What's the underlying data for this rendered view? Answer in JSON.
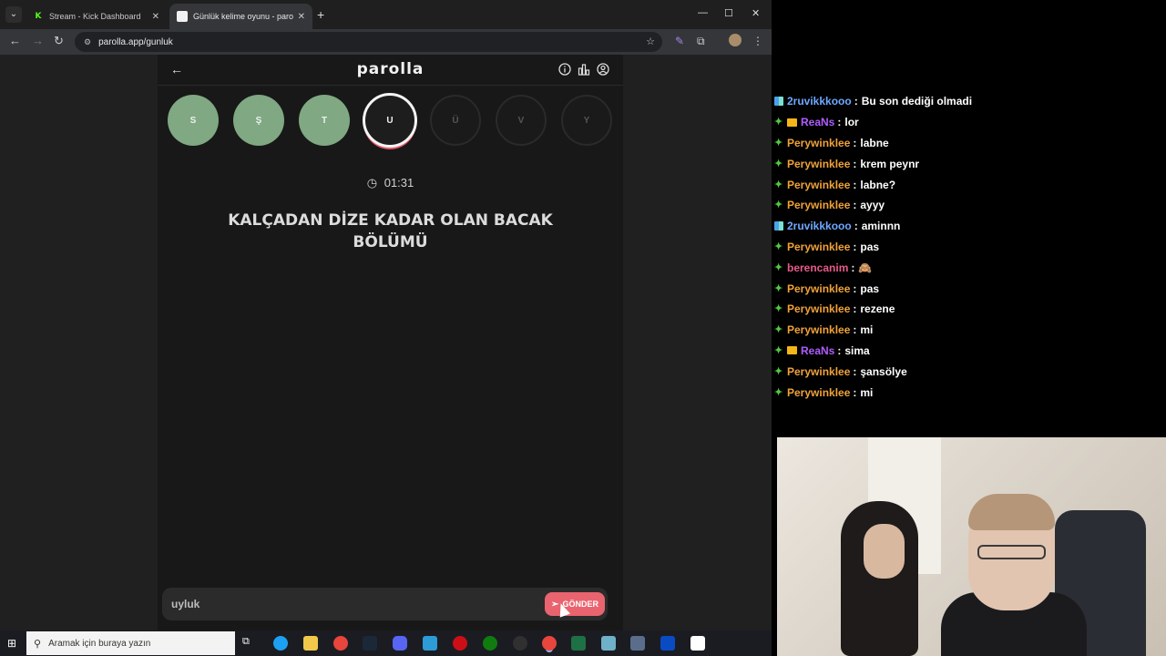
{
  "browser": {
    "tabs": [
      {
        "title": "Stream - Kick Dashboard",
        "favicon": "kick-icon",
        "active": false
      },
      {
        "title": "Günlük kelime oyunu - paro",
        "favicon": "parolla-icon",
        "active": true
      }
    ],
    "url": "parolla.app/gunluk"
  },
  "app": {
    "brand": "parolla",
    "letters": [
      {
        "letter": "S",
        "state": "done"
      },
      {
        "letter": "Ş",
        "state": "done"
      },
      {
        "letter": "T",
        "state": "done"
      },
      {
        "letter": "U",
        "state": "current"
      },
      {
        "letter": "Ü",
        "state": "pending"
      },
      {
        "letter": "V",
        "state": "pending"
      },
      {
        "letter": "Y",
        "state": "pending"
      }
    ],
    "timer": "01:31",
    "question": "KALÇADAN DİZE KADAR OLAN BACAK BÖLÜMÜ",
    "answer_value": "uyluk",
    "send_label": "GÖNDER"
  },
  "taskbar": {
    "search_placeholder": "Aramak için buraya yazın"
  },
  "chat": {
    "messages": [
      {
        "user": "2ruvikkkooo",
        "text": "Bu son dediği olmadi",
        "color": "#6fa8ff",
        "badge": "grid"
      },
      {
        "user": "ReaNs",
        "text": "lor",
        "color": "#b05cff",
        "badge": "crown"
      },
      {
        "user": "Perywinklee",
        "text": "labne",
        "color": "#f0a23a",
        "badge": "green"
      },
      {
        "user": "Perywinklee",
        "text": "krem peynr",
        "color": "#f0a23a",
        "badge": "green"
      },
      {
        "user": "Perywinklee",
        "text": "labne?",
        "color": "#f0a23a",
        "badge": "green"
      },
      {
        "user": "Perywinklee",
        "text": "ayyy",
        "color": "#f0a23a",
        "badge": "green"
      },
      {
        "user": "2ruvikkkooo",
        "text": "aminnn",
        "color": "#6fa8ff",
        "badge": "grid"
      },
      {
        "user": "Perywinklee",
        "text": "pas",
        "color": "#f0a23a",
        "badge": "green"
      },
      {
        "user": "berencanim",
        "text": "🙈",
        "color": "#e85a8a",
        "badge": "green"
      },
      {
        "user": "Perywinklee",
        "text": "pas",
        "color": "#f0a23a",
        "badge": "green"
      },
      {
        "user": "Perywinklee",
        "text": "rezene",
        "color": "#f0a23a",
        "badge": "green"
      },
      {
        "user": "Perywinklee",
        "text": "mi",
        "color": "#f0a23a",
        "badge": "green"
      },
      {
        "user": "ReaNs",
        "text": "sima",
        "color": "#b05cff",
        "badge": "crown"
      },
      {
        "user": "Perywinklee",
        "text": "şansölye",
        "color": "#f0a23a",
        "badge": "green"
      },
      {
        "user": "Perywinklee",
        "text": "mi",
        "color": "#f0a23a",
        "badge": "green"
      }
    ]
  }
}
